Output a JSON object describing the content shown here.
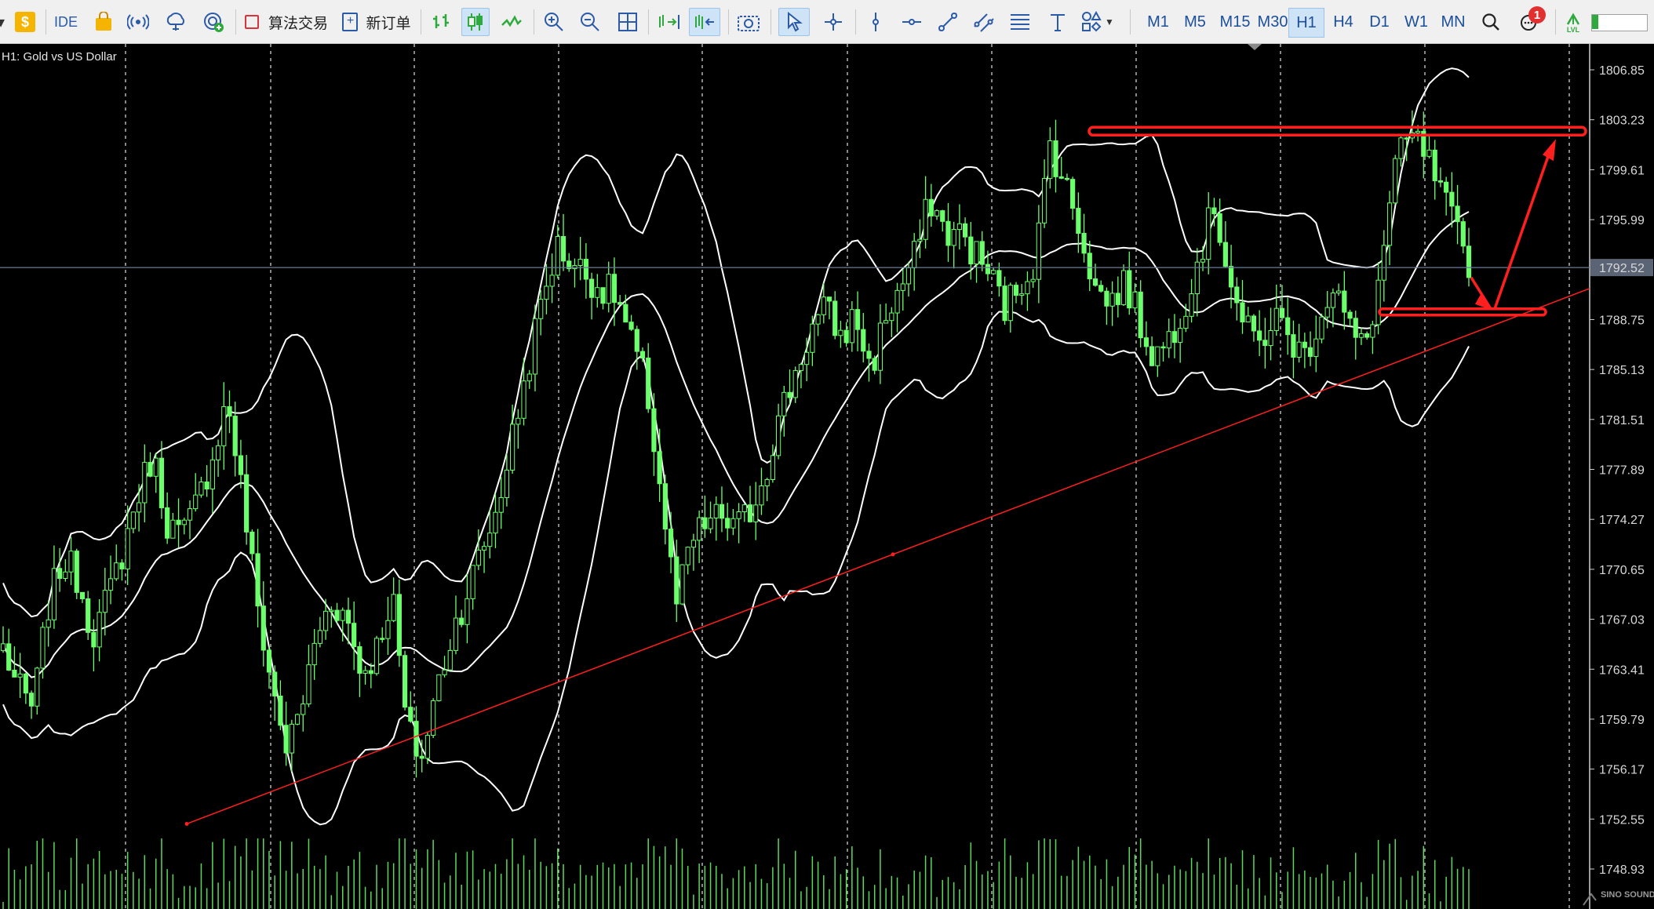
{
  "toolbar": {
    "ide_label": "IDE",
    "algo_label": "算法交易",
    "new_order_label": "新订单",
    "timeframes": [
      "M1",
      "M5",
      "M15",
      "M30",
      "H1",
      "H4",
      "D1",
      "W1",
      "MN"
    ],
    "active_timeframe": "H1",
    "notification_count": "1",
    "lvl_label": "LVL"
  },
  "chart": {
    "symbol_label": "H1:  Gold vs US Dollar",
    "current_price": "1792.52",
    "colors": {
      "candles": "#6cff6c",
      "bands": "#ffffff",
      "annotations": "#ff1f1f",
      "price_line": "#6a7a94"
    }
  },
  "chart_data": {
    "type": "candlestick",
    "title": "",
    "symbol": "Gold vs US Dollar",
    "timeframe": "H1",
    "y_ticks": [
      1806.85,
      1803.23,
      1799.61,
      1795.99,
      1792.52,
      1788.75,
      1785.13,
      1781.51,
      1777.89,
      1774.27,
      1770.65,
      1767.03,
      1763.41,
      1759.79,
      1756.17,
      1752.55,
      1748.93
    ],
    "ylim": [
      1748.93,
      1806.85
    ],
    "current_price": 1792.52,
    "indicators": [
      "Bollinger Bands"
    ],
    "annotations": [
      "resistance line ~1802.4",
      "support line ~1789.3",
      "ascending trendline",
      "bounce arrow"
    ],
    "close_path": [
      1765.0,
      1762.0,
      1760.5,
      1768.0,
      1771.5,
      1770.0,
      1766.0,
      1768.5,
      1772.0,
      1776.0,
      1779.0,
      1774.0,
      1773.0,
      1775.5,
      1779.0,
      1783.0,
      1776.0,
      1768.0,
      1762.0,
      1757.5,
      1761.0,
      1766.0,
      1768.5,
      1767.0,
      1763.0,
      1765.0,
      1769.0,
      1759.0,
      1757.0,
      1762.0,
      1766.0,
      1769.0,
      1772.0,
      1775.0,
      1780.0,
      1785.0,
      1790.0,
      1794.0,
      1793.0,
      1792.0,
      1791.0,
      1790.5,
      1787.0,
      1784.0,
      1776.0,
      1768.0,
      1772.5,
      1774.0,
      1774.5,
      1773.5,
      1775.0,
      1778.0,
      1782.0,
      1785.0,
      1788.0,
      1789.5,
      1787.5,
      1789.0,
      1785.0,
      1789.0,
      1791.0,
      1793.5,
      1797.5,
      1795.0,
      1795.0,
      1793.5,
      1792.0,
      1789.5,
      1791.5,
      1793.0,
      1801.5,
      1798.5,
      1795.5,
      1791.0,
      1790.0,
      1791.5,
      1788.5,
      1786.0,
      1787.5,
      1790.0,
      1793.5,
      1797.0,
      1792.0,
      1788.0,
      1787.0,
      1789.0,
      1787.5,
      1786.0,
      1789.0,
      1791.5,
      1788.0,
      1786.5,
      1791.5,
      1799.5,
      1802.0,
      1801.0,
      1798.0,
      1795.5,
      1793.0
    ]
  }
}
